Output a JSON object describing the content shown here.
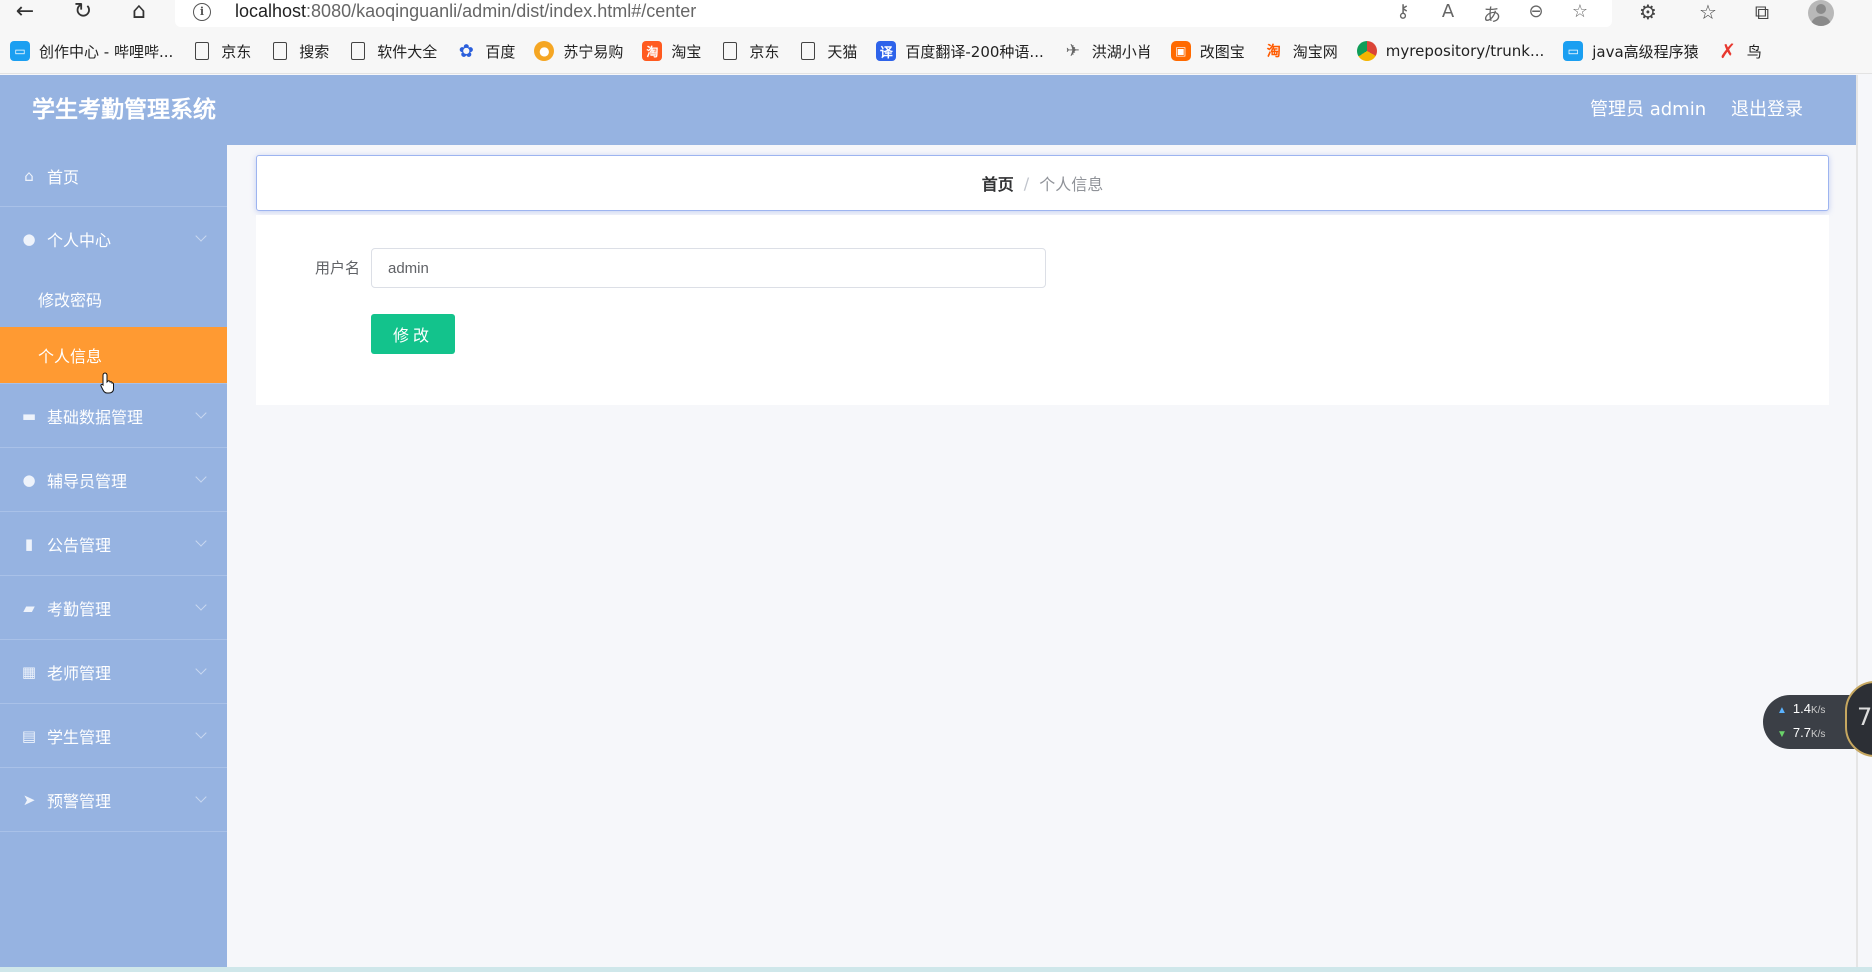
{
  "browser": {
    "url_host": "localhost",
    "url_path": ":8080/kaoqinguanli/admin/dist/index.html#/center",
    "bookmarks": [
      {
        "label": "创作中心 - 哔哩哔...",
        "icon": "bilibili-tv-icon"
      },
      {
        "label": "京东",
        "icon": "page-icon"
      },
      {
        "label": "搜索",
        "icon": "page-icon"
      },
      {
        "label": "软件大全",
        "icon": "page-icon"
      },
      {
        "label": "百度",
        "icon": "baidu-paw-icon"
      },
      {
        "label": "苏宁易购",
        "icon": "suning-icon"
      },
      {
        "label": "淘宝",
        "icon": "taobao-icon"
      },
      {
        "label": "京东",
        "icon": "page-icon"
      },
      {
        "label": "天猫",
        "icon": "page-icon"
      },
      {
        "label": "百度翻译-200种语...",
        "icon": "translate-icon"
      },
      {
        "label": "洪湖小肖",
        "icon": "bird-icon"
      },
      {
        "label": "改图宝",
        "icon": "gaitubao-icon"
      },
      {
        "label": "淘宝网",
        "icon": "taobao-icon"
      },
      {
        "label": "myrepository/trunk...",
        "icon": "chrome-icon"
      },
      {
        "label": "java高级程序猿",
        "icon": "bilibili-tv-icon"
      },
      {
        "label": "鸟",
        "icon": "swallow-icon"
      }
    ]
  },
  "header": {
    "title": "学生考勤管理系统",
    "admin": "管理员 admin",
    "logout": "退出登录"
  },
  "sidebar": {
    "home": "首页",
    "personal_center": "个人中心",
    "change_password": "修改密码",
    "personal_info": "个人信息",
    "items": [
      {
        "label": "基础数据管理",
        "icon": "monitor-icon"
      },
      {
        "label": "辅导员管理",
        "icon": "user-icon"
      },
      {
        "label": "公告管理",
        "icon": "bar-chart-icon"
      },
      {
        "label": "考勤管理",
        "icon": "chat-icon"
      },
      {
        "label": "老师管理",
        "icon": "grid-icon"
      },
      {
        "label": "学生管理",
        "icon": "clipboard-icon"
      },
      {
        "label": "预警管理",
        "icon": "send-icon"
      }
    ]
  },
  "breadcrumb": {
    "home": "首页",
    "separator": "/",
    "current": "个人信息"
  },
  "form": {
    "username_label": "用户名",
    "username_value": "admin",
    "submit_label": "修改"
  },
  "net_widget": {
    "up": "1.4",
    "down": "7.7",
    "unit": "K/s",
    "dial": "7"
  },
  "colors": {
    "header_bg": "#96b3e1",
    "active_menu": "#ff9a32",
    "primary_button": "#13c38c"
  }
}
